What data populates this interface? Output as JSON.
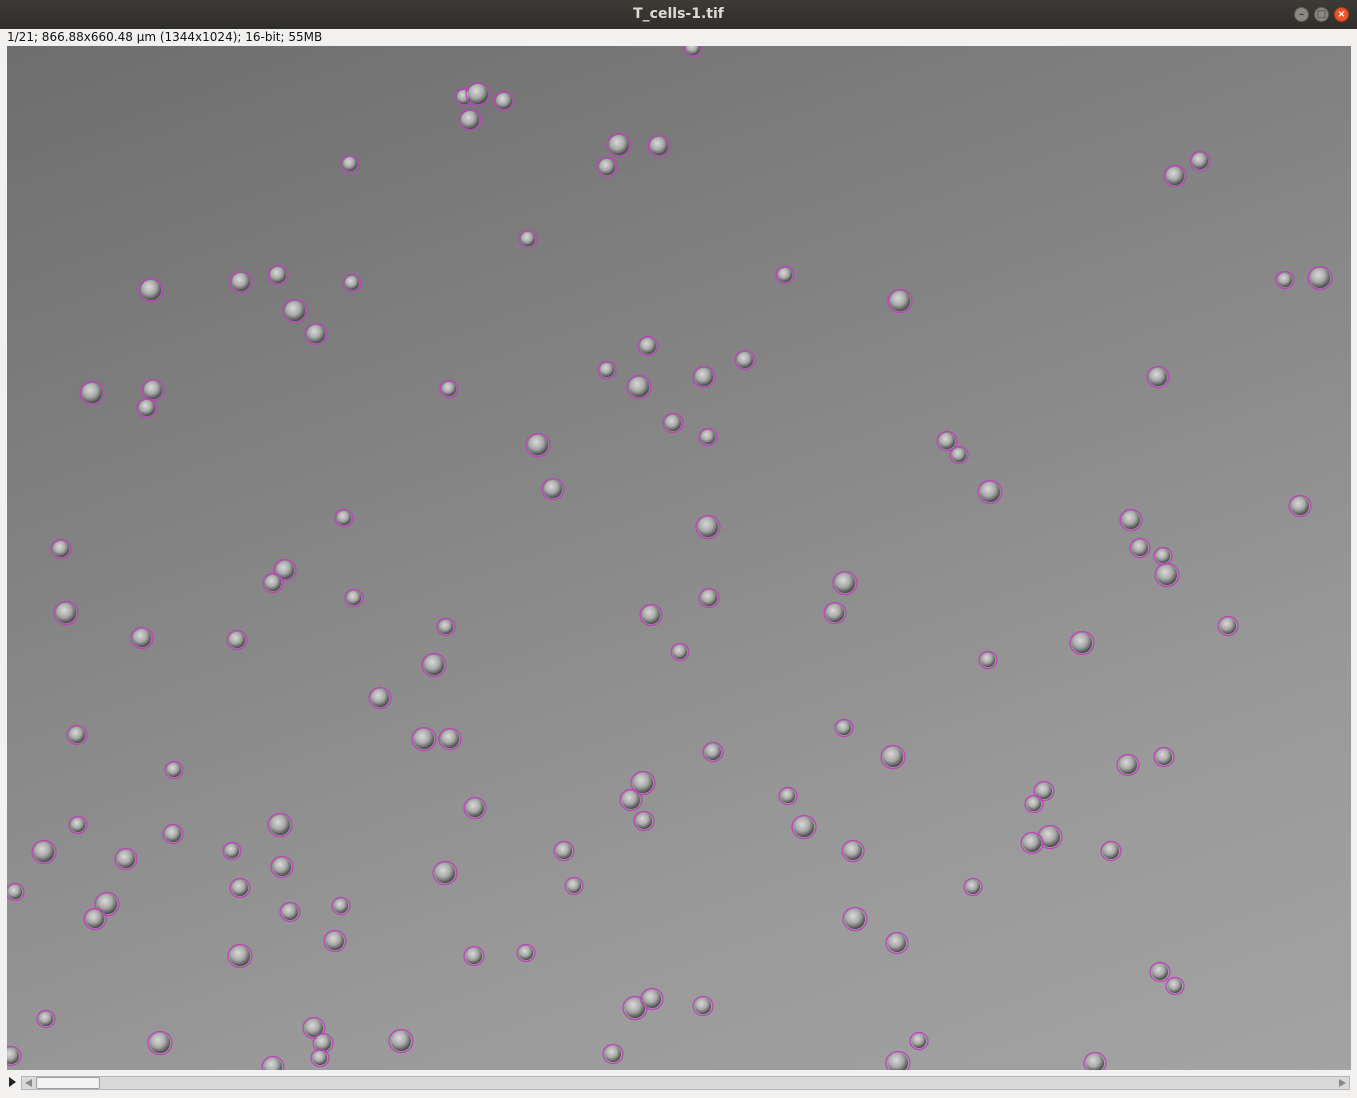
{
  "window": {
    "title": "T_cells-1.tif",
    "minimize_icon": "minimize-icon",
    "maximize_icon": "maximize-icon",
    "close_icon": "close-icon"
  },
  "image_info": {
    "text": "1/21; 866.88x660.48 µm (1344x1024); 16-bit; 55MB"
  },
  "image": {
    "description_icon": "microscopy-image",
    "roi_color": "#c040c0"
  },
  "slice_scrollbar": {
    "play_icon": "play-icon",
    "left_arrow_icon": "arrow-left-icon",
    "right_arrow_icon": "arrow-right-icon",
    "current_slice": 1,
    "total_slices": 21
  }
}
